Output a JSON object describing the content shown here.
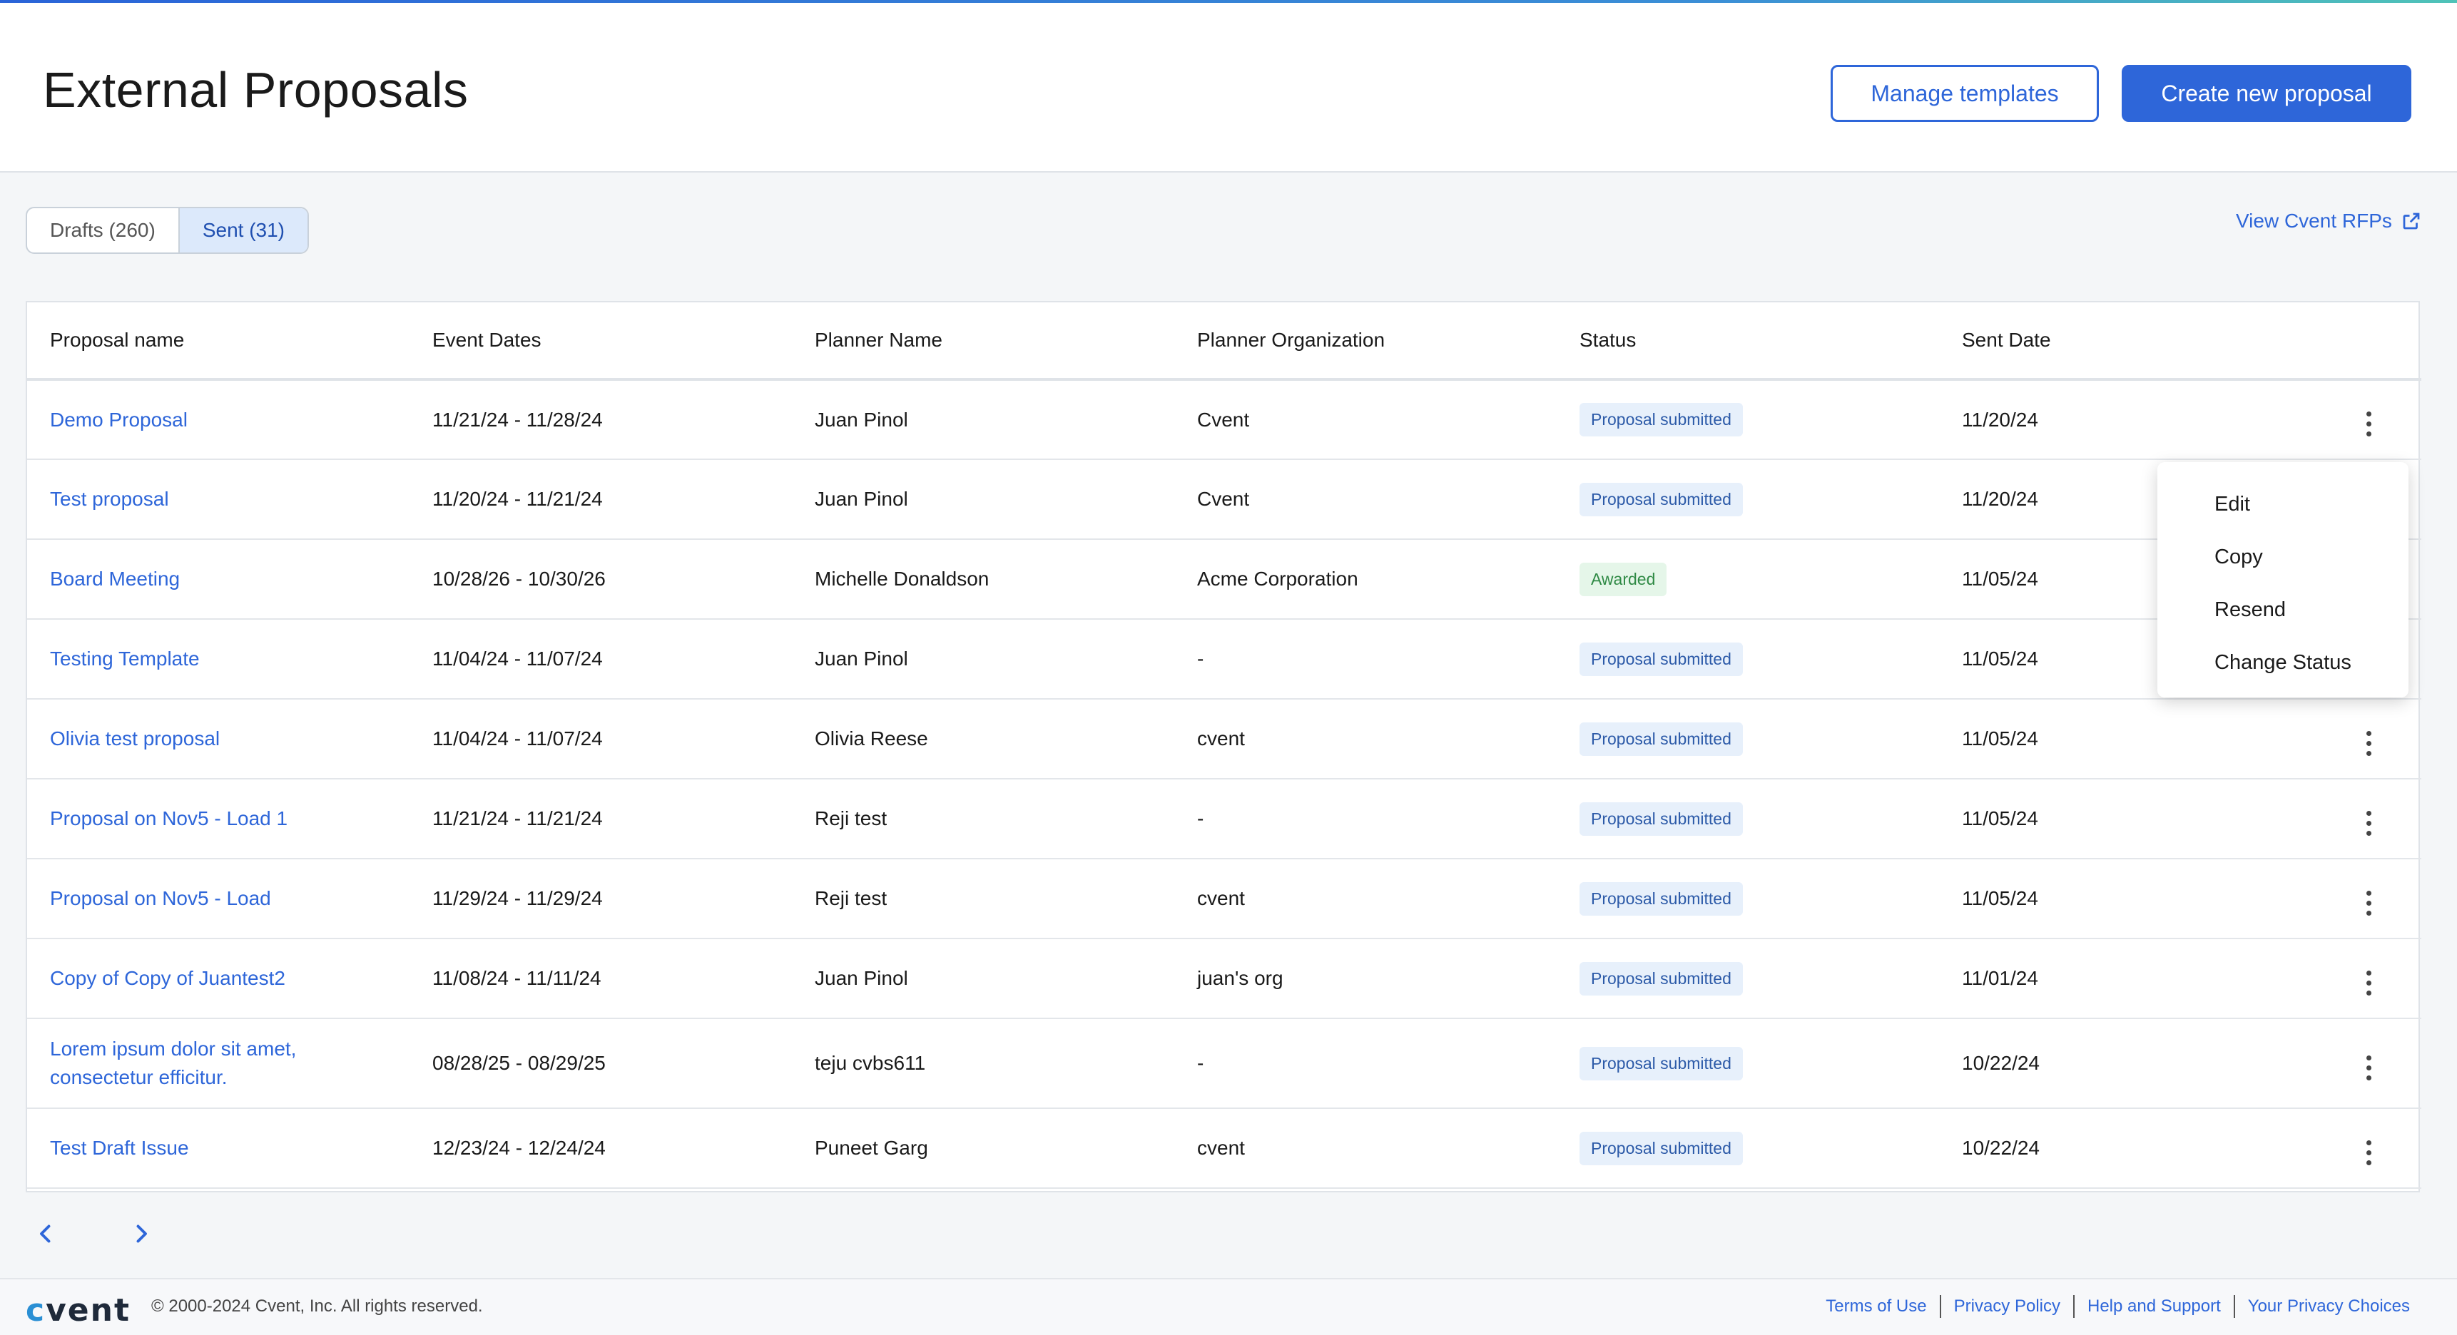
{
  "header": {
    "title": "External Proposals",
    "manage_templates_label": "Manage templates",
    "create_label": "Create new proposal"
  },
  "tabs": [
    {
      "label": "Drafts (260)",
      "active": false
    },
    {
      "label": "Sent (31)",
      "active": true
    }
  ],
  "rfp_link": {
    "label": "View Cvent RFPs",
    "icon": "external-link-icon"
  },
  "table": {
    "columns": [
      "Proposal name",
      "Event Dates",
      "Planner Name",
      "Planner Organization",
      "Status",
      "Sent Date"
    ],
    "rows": [
      {
        "name": "Demo Proposal",
        "dates": "11/21/24 - 11/28/24",
        "planner": "Juan Pinol",
        "org": "Cvent",
        "status": "Proposal submitted",
        "sent": "11/20/24"
      },
      {
        "name": "Test proposal",
        "dates": "11/20/24 - 11/21/24",
        "planner": "Juan Pinol",
        "org": "Cvent",
        "status": "Proposal submitted",
        "sent": "11/20/24"
      },
      {
        "name": "Board Meeting",
        "dates": "10/28/26 - 10/30/26",
        "planner": "Michelle Donaldson",
        "org": "Acme Corporation",
        "status": "Awarded",
        "sent": "11/05/24"
      },
      {
        "name": "Testing Template",
        "dates": "11/04/24 - 11/07/24",
        "planner": "Juan Pinol",
        "org": "-",
        "status": "Proposal submitted",
        "sent": "11/05/24"
      },
      {
        "name": "Olivia test proposal",
        "dates": "11/04/24 - 11/07/24",
        "planner": "Olivia Reese",
        "org": "cvent",
        "status": "Proposal submitted",
        "sent": "11/05/24"
      },
      {
        "name": "Proposal on Nov5 - Load 1",
        "dates": "11/21/24 - 11/21/24",
        "planner": "Reji test",
        "org": "-",
        "status": "Proposal submitted",
        "sent": "11/05/24"
      },
      {
        "name": "Proposal on Nov5 - Load",
        "dates": "11/29/24 - 11/29/24",
        "planner": "Reji test",
        "org": "cvent",
        "status": "Proposal submitted",
        "sent": "11/05/24"
      },
      {
        "name": "Copy of Copy of Juantest2",
        "dates": "11/08/24 - 11/11/24",
        "planner": "Juan Pinol",
        "org": "juan's org",
        "status": "Proposal submitted",
        "sent": "11/01/24"
      },
      {
        "name": "Lorem ipsum dolor sit amet, consectetur efficitur.",
        "dates": "08/28/25 - 08/29/25",
        "planner": "teju cvbs611",
        "org": "-",
        "status": "Proposal submitted",
        "sent": "10/22/24"
      },
      {
        "name": "Test Draft Issue",
        "dates": "12/23/24 - 12/24/24",
        "planner": "Puneet Garg",
        "org": "cvent",
        "status": "Proposal submitted",
        "sent": "10/22/24"
      }
    ]
  },
  "dropdown": {
    "items": [
      "Edit",
      "Copy",
      "Resend",
      "Change Status"
    ]
  },
  "pager": {
    "prev_icon": "chevron-left-icon",
    "next_icon": "chevron-right-icon"
  },
  "footer": {
    "logo": "cvent",
    "copyright": "© 2000-2024 Cvent, Inc. All rights reserved.",
    "links": [
      "Terms of Use",
      "Privacy Policy",
      "Help and Support",
      "Your Privacy Choices"
    ]
  },
  "colors": {
    "accent": "#2e66d9",
    "submitted_bg": "#e7f0fb",
    "awarded_bg": "#e5f6e9",
    "awarded_text": "#2f8a45"
  }
}
